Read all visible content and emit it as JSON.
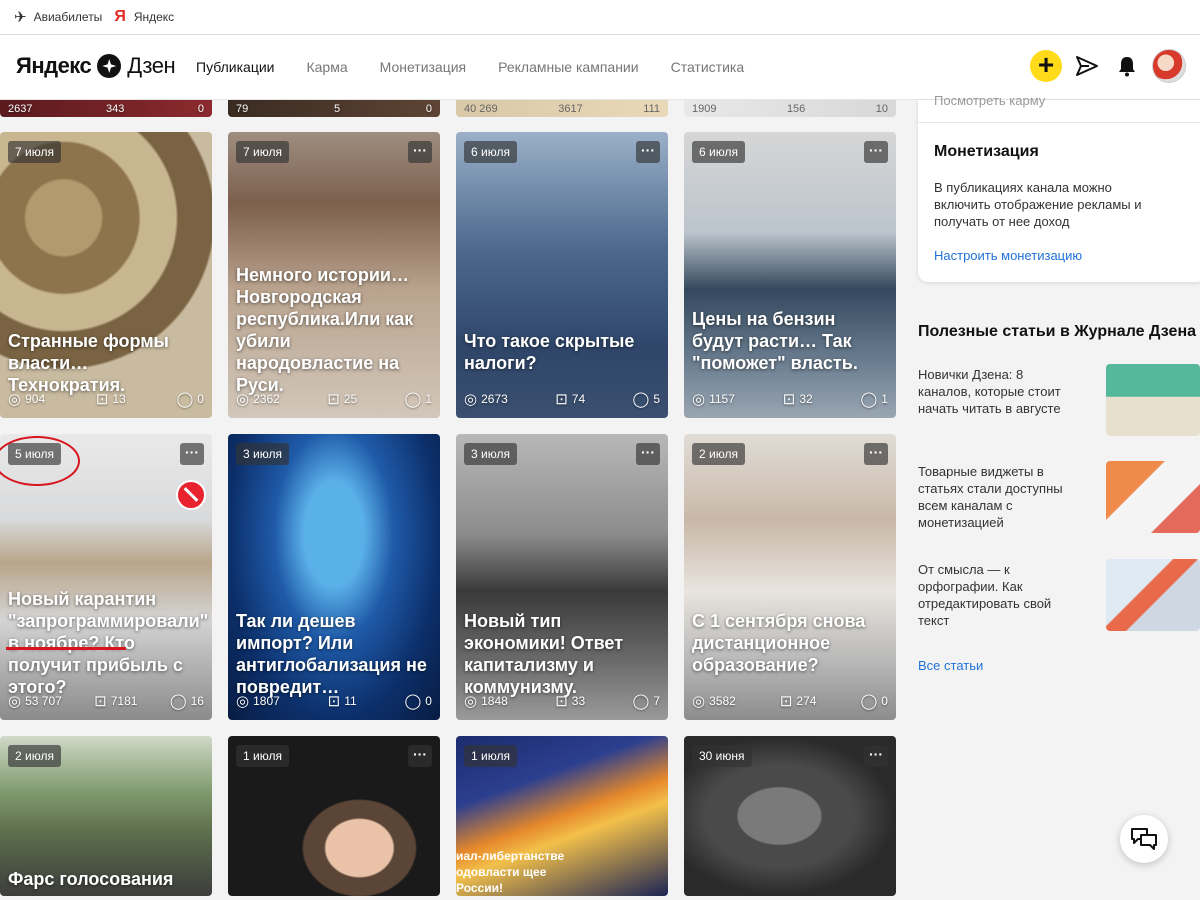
{
  "bookmarks": [
    {
      "label": "Авиабилеты",
      "icon": "plane-icon"
    },
    {
      "label": "Яндекс",
      "icon": "yandex-icon"
    }
  ],
  "header": {
    "logo_brand": "Яндекс",
    "logo_product": "Дзен",
    "nav": [
      "Публикации",
      "Карма",
      "Монетизация",
      "Рекламные кампании",
      "Статистика"
    ],
    "active_nav": "Публикации"
  },
  "top_strip_stats": [
    [
      "2637",
      "343",
      "0"
    ],
    [
      "79",
      "5",
      "0"
    ],
    [
      "40 269",
      "3617",
      "111"
    ],
    [
      "1909",
      "156",
      "10"
    ]
  ],
  "cards": [
    {
      "date": "7 июля",
      "title": "Странные формы власти… Технократия.",
      "views": "904",
      "reads": "13",
      "comments": "0"
    },
    {
      "date": "7 июля",
      "title": "Немного истории… Новгородская республика.Или как убили народовластие на Руси.",
      "views": "2362",
      "reads": "25",
      "comments": "1"
    },
    {
      "date": "6 июля",
      "title": "Что такое скрытые налоги?",
      "views": "2673",
      "reads": "74",
      "comments": "5"
    },
    {
      "date": "6 июля",
      "title": "Цены на бензин будут расти… Так \"поможет\" власть.",
      "views": "1157",
      "reads": "32",
      "comments": "1"
    },
    {
      "date": "5 июля",
      "title": "Новый карантин \"запрограммировали\" в ноябре? Кто получит прибыль с этого?",
      "views": "53 707",
      "reads": "7181",
      "comments": "16"
    },
    {
      "date": "3 июля",
      "title": "Так ли дешев импорт? Или антиглобализация не повредит…",
      "views": "1807",
      "reads": "11",
      "comments": "0"
    },
    {
      "date": "3 июля",
      "title": "Новый тип экономики! Ответ капитализму и коммунизму.",
      "views": "1848",
      "reads": "33",
      "comments": "7"
    },
    {
      "date": "2 июля",
      "title": "С 1 сентября снова дистанционное образование?",
      "views": "3582",
      "reads": "274",
      "comments": "0"
    },
    {
      "date": "2 июля",
      "title": "Фарс голосования под"
    },
    {
      "date": "1 июля",
      "title": ""
    },
    {
      "date": "1 июля",
      "title": "",
      "overlay_text": "иал-либертанстве одовласти щее России!"
    },
    {
      "date": "30 июня",
      "title": ""
    }
  ],
  "sidebar": {
    "karma_link": "Посмотреть карму",
    "monetization": {
      "title": "Монетизация",
      "text": "В публикациях канала можно включить отображение рекламы и получать от нее доход",
      "link": "Настроить монетизацию"
    },
    "journal_title": "Полезные статьи в Журнале Дзена",
    "articles": [
      "Новички Дзена: 8 каналов, которые стоит начать читать в августе",
      "Товарные виджеты в статьях стали доступны всем каналам с монетизацией",
      "От смысла — к орфографии. Как отредактировать свой текст"
    ],
    "all_link": "Все статьи"
  },
  "colors": {
    "accent_yellow": "#ffdb1a",
    "link_blue": "#2173d9",
    "alert_red": "#e8232d"
  }
}
